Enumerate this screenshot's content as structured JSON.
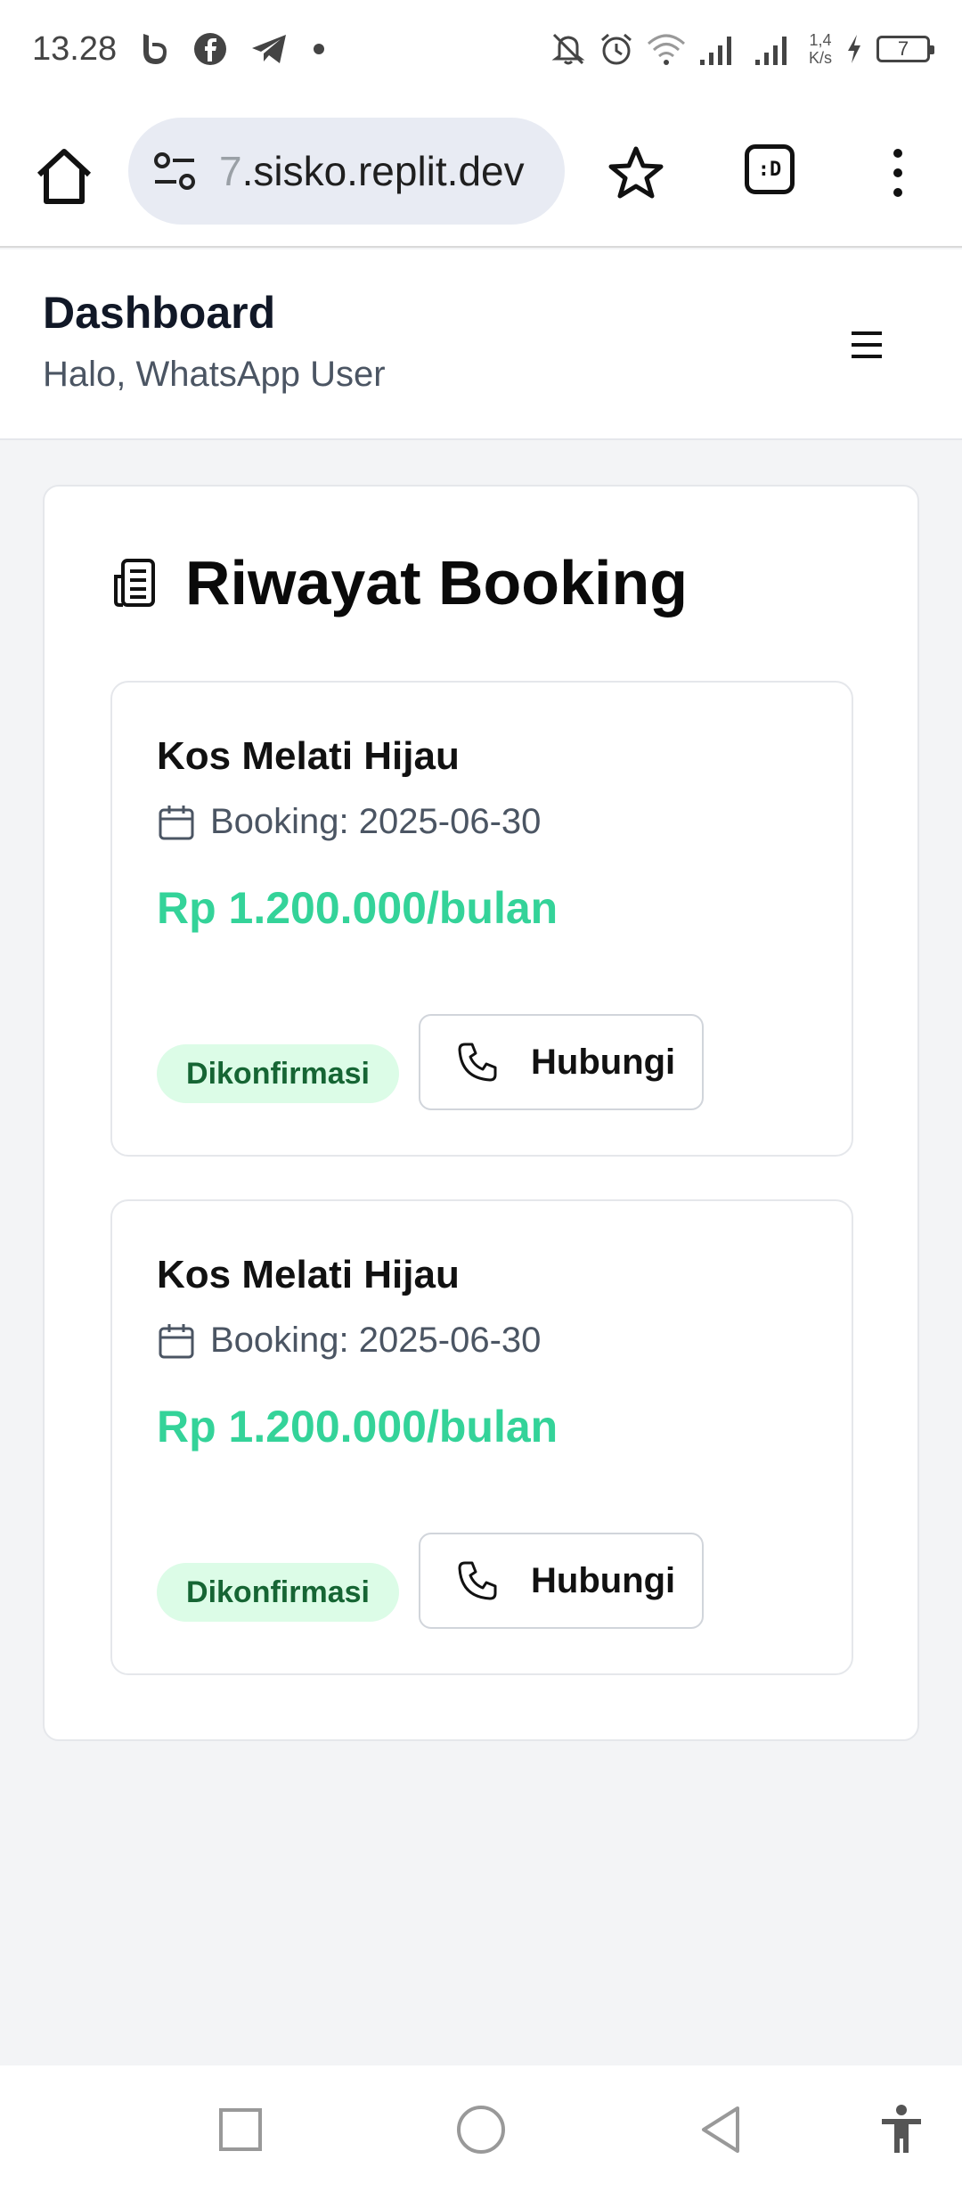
{
  "status_bar": {
    "time": "13.28",
    "net_speed_value": "1,4",
    "net_speed_unit": "K/s",
    "battery": "7",
    "icons": [
      "b-app-icon",
      "facebook-icon",
      "telegram-icon",
      "dot-icon",
      "mute-icon",
      "alarm-icon",
      "wifi-icon",
      "signal-icon",
      "signal-icon",
      "charging-icon",
      "battery-icon"
    ]
  },
  "browser": {
    "url_fade": "7",
    "url_main": ".sisko.replit.dev",
    "tabs_label": ":D"
  },
  "header": {
    "title": "Dashboard",
    "subtitle": "Halo, WhatsApp User"
  },
  "section": {
    "title": "Riwayat Booking"
  },
  "bookings": [
    {
      "name": "Kos Melati Hijau",
      "date": "Booking: 2025-06-30",
      "price": "Rp 1.200.000/bulan",
      "status": "Dikonfirmasi",
      "action": "Hubungi"
    },
    {
      "name": "Kos Melati Hijau",
      "date": "Booking: 2025-06-30",
      "price": "Rp 1.200.000/bulan",
      "status": "Dikonfirmasi",
      "action": "Hubungi"
    }
  ],
  "colors": {
    "price": "#34d399",
    "badge_bg": "#dcfce7",
    "badge_text": "#166534",
    "page_bg": "#f3f4f6"
  }
}
